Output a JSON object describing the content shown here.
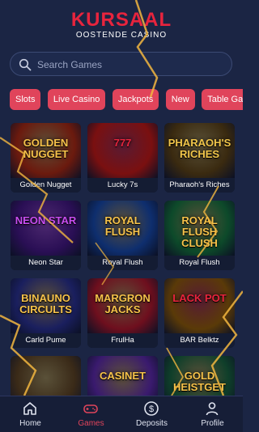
{
  "header": {
    "brand": "KURSAAL",
    "subtitle": "OOSTENDE CASINO"
  },
  "search": {
    "placeholder": "Search Games"
  },
  "categories": [
    {
      "label": "Slots"
    },
    {
      "label": "Live Casino"
    },
    {
      "label": "Jackpots"
    },
    {
      "label": "New"
    },
    {
      "label": "Table Games"
    }
  ],
  "games": [
    {
      "caption": "Golden Nugget",
      "art_text": "GOLDEN NUGGET",
      "bg": "#6b1a0e",
      "accent": "#f6c24a"
    },
    {
      "caption": "Lucky 7s",
      "art_text": "777",
      "bg": "#7a1010",
      "accent": "#e8243d"
    },
    {
      "caption": "Pharaoh's Riches",
      "art_text": "PHARAOH'S RICHES",
      "bg": "#3a2a10",
      "accent": "#f0c54a"
    },
    {
      "caption": "Neon Star",
      "art_text": "NEON STAR",
      "bg": "#2a0f55",
      "accent": "#c84df0"
    },
    {
      "caption": "Royal Flush",
      "art_text": "ROYAL FLUSH",
      "bg": "#0e2e6e",
      "accent": "#f6c24a"
    },
    {
      "caption": "Royal Flush",
      "art_text": "ROYAL FLUSH CLUSH",
      "bg": "#0d4a2a",
      "accent": "#f6c24a"
    },
    {
      "caption": "Carld Pume",
      "art_text": "BINAUNO CIRCULTS",
      "bg": "#1a1f5e",
      "accent": "#f6c24a"
    },
    {
      "caption": "FrulHa",
      "art_text": "MARGRON JACKS",
      "bg": "#6e0f1e",
      "accent": "#f6c24a"
    },
    {
      "caption": "BAR Belktz",
      "art_text": "LACK POT",
      "bg": "#5a3a08",
      "accent": "#e8243d"
    },
    {
      "caption": "",
      "art_text": "",
      "bg": "#3a2a18",
      "accent": "#f0c54a"
    },
    {
      "caption": "",
      "art_text": "CASINET",
      "bg": "#3a1a6e",
      "accent": "#f6c24a"
    },
    {
      "caption": "",
      "art_text": "GOLD HEISTGET",
      "bg": "#0f3f2a",
      "accent": "#f6c24a"
    }
  ],
  "nav": [
    {
      "label": "Home",
      "icon": "home-icon"
    },
    {
      "label": "Games",
      "icon": "gamepad-icon"
    },
    {
      "label": "Deposits",
      "icon": "dollar-icon"
    },
    {
      "label": "Profile",
      "icon": "user-icon"
    }
  ],
  "colors": {
    "accent": "#e0445b",
    "brand": "#e8243d",
    "background": "#1b2544"
  }
}
